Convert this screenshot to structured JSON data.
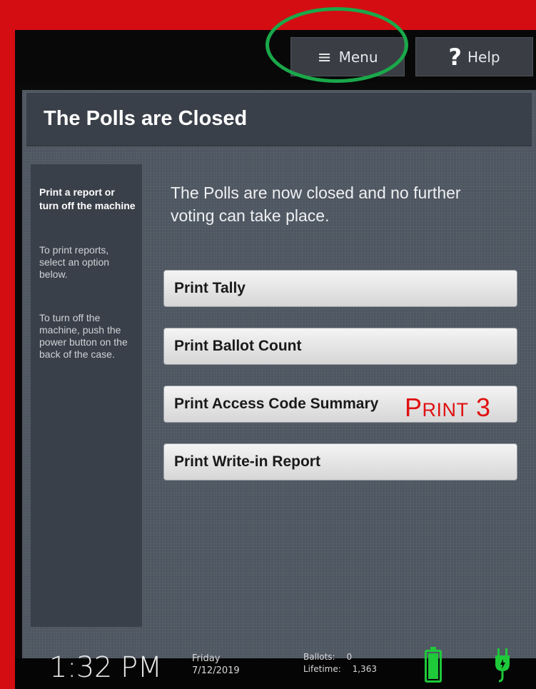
{
  "topbar": {
    "menu_label": "Menu",
    "help_label": "Help",
    "menu_icon": "hamburger-icon",
    "help_icon": "question-icon"
  },
  "title": "The Polls are Closed",
  "sidebar": {
    "heading": "Print a report or turn off the machine",
    "para1": "To print reports, select an option below.",
    "para2": "To turn off the machine, push the power button on the back of the case."
  },
  "intro": "The Polls are now closed and no further voting can take place.",
  "actions": [
    {
      "label": "Print Tally"
    },
    {
      "label": "Print Ballot Count"
    },
    {
      "label": "Print Access Code Summary"
    },
    {
      "label": "Print Write-in Report"
    }
  ],
  "annotation": {
    "first": "P",
    "rest": "RINT",
    "number": "3",
    "color": "#e01010"
  },
  "status": {
    "time": "1:32 PM",
    "day": "Friday",
    "date": "7/12/2019",
    "ballots_label": "Ballots:",
    "ballots_value": "0",
    "lifetime_label": "Lifetime:",
    "lifetime_value": "1,363",
    "battery_color": "#1ec93a"
  },
  "colors": {
    "border_red": "#d40d12",
    "highlight_ring": "#1aa84a"
  }
}
